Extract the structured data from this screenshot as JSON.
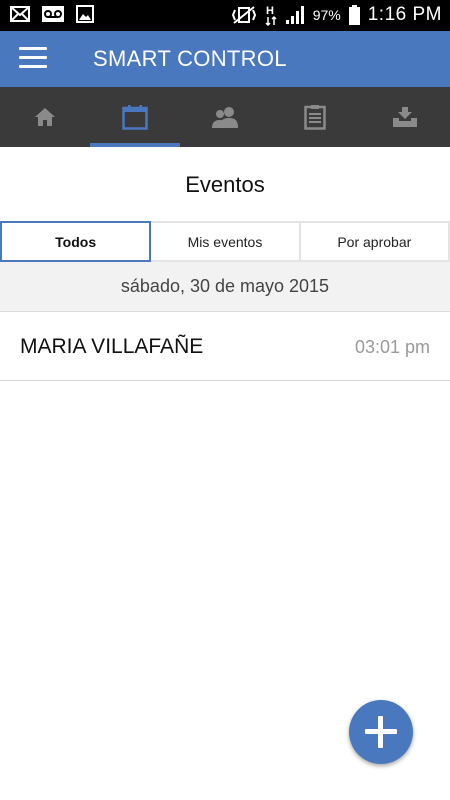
{
  "status_bar": {
    "icons_left": [
      "mail-icon",
      "voicemail-icon",
      "image-icon"
    ],
    "icons_right": [
      "vibrate-icon",
      "h-network-icon",
      "signal-icon",
      "battery-icon"
    ],
    "battery": "97%",
    "time": "1:16 PM"
  },
  "app_bar": {
    "title": "SMART CONTROL",
    "menu_icon": "hamburger-menu-icon",
    "color": "#4a78bf"
  },
  "tabs": [
    {
      "icon": "home-icon",
      "active": false
    },
    {
      "icon": "calendar-icon",
      "active": true
    },
    {
      "icon": "users-icon",
      "active": false
    },
    {
      "icon": "clipboard-icon",
      "active": false
    },
    {
      "icon": "download-icon",
      "active": false
    }
  ],
  "main": {
    "heading": "Eventos",
    "segments": [
      {
        "label": "Todos",
        "active": true
      },
      {
        "label": "Mis eventos",
        "active": false
      },
      {
        "label": "Por aprobar",
        "active": false
      }
    ],
    "date_header": "sábado, 30 de mayo 2015",
    "events": [
      {
        "name": "MARIA VILLAFAÑE",
        "time": "03:01 pm"
      }
    ]
  },
  "fab": {
    "icon": "plus-icon"
  }
}
